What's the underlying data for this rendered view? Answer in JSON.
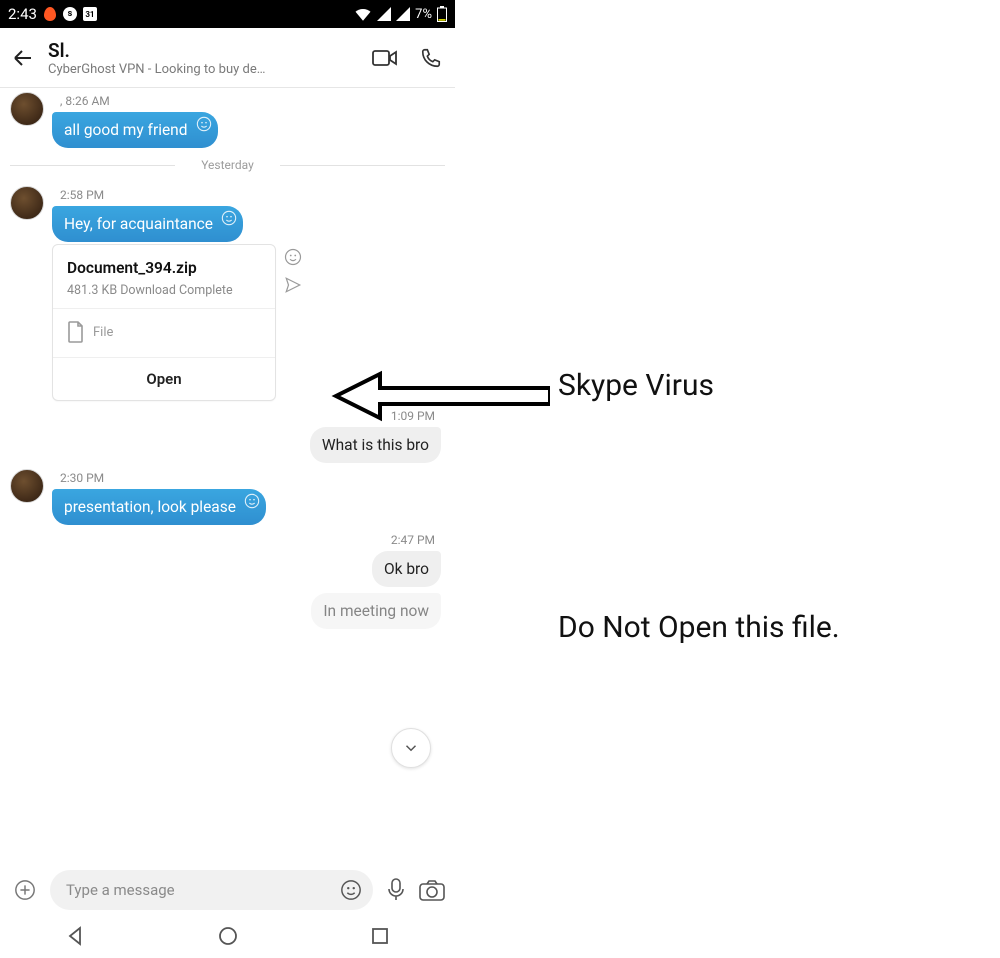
{
  "statusbar": {
    "time": "2:43",
    "calendar_day": "31",
    "spotify_letter": "s",
    "battery_pct": "7%"
  },
  "header": {
    "contact_name": "Sl.",
    "subtitle": "CyberGhost VPN - Looking to buy de…"
  },
  "divider_yesterday": "Yesterday",
  "messages": {
    "m1": {
      "time": ", 8:26 AM",
      "text": "all good my friend"
    },
    "m2": {
      "time": "2:58 PM",
      "text": "Hey, for acquaintance"
    },
    "file": {
      "name": "Document_394.zip",
      "meta": "481.3 KB Download Complete",
      "type_label": "File",
      "open_label": "Open"
    },
    "out1": {
      "time": "1:09 PM",
      "text": "What is this bro"
    },
    "m3": {
      "time": "2:30 PM",
      "text": "presentation, look please"
    },
    "out2": {
      "time": "2:47 PM",
      "text": "Ok bro"
    },
    "out3_partial": "In meeting now"
  },
  "composer": {
    "placeholder": "Type a message"
  },
  "annotations": {
    "label1": "Skype Virus",
    "label2": "Do Not Open this file."
  }
}
